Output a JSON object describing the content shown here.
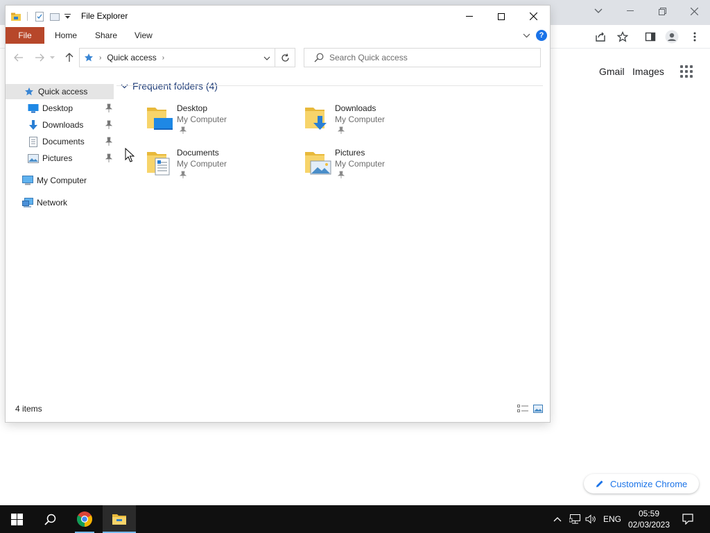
{
  "chrome": {
    "links": {
      "gmail": "Gmail",
      "images": "Images"
    },
    "customize_label": "Customize Chrome",
    "accent": "#1a73e8"
  },
  "explorer": {
    "title": "File Explorer",
    "ribbon_tabs": [
      "File",
      "Home",
      "Share",
      "View"
    ],
    "file_tab_color": "#b7472a",
    "address": {
      "location": "Quick access"
    },
    "search": {
      "placeholder": "Search Quick access",
      "value": ""
    },
    "nav": {
      "quick_access": "Quick access",
      "pinned": [
        "Desktop",
        "Downloads",
        "Documents",
        "Pictures"
      ],
      "this_pc": "My Computer",
      "network": "Network"
    },
    "group": {
      "title": "Frequent folders (4)"
    },
    "folders": [
      {
        "name": "Desktop",
        "location": "My Computer",
        "icon": "desktop-folder-icon"
      },
      {
        "name": "Downloads",
        "location": "My Computer",
        "icon": "downloads-folder-icon"
      },
      {
        "name": "Documents",
        "location": "My Computer",
        "icon": "documents-folder-icon"
      },
      {
        "name": "Pictures",
        "location": "My Computer",
        "icon": "pictures-folder-icon"
      }
    ],
    "status": {
      "count": "4 items"
    }
  },
  "taskbar": {
    "language": "ENG",
    "time": "05:59",
    "date": "02/03/2023"
  }
}
